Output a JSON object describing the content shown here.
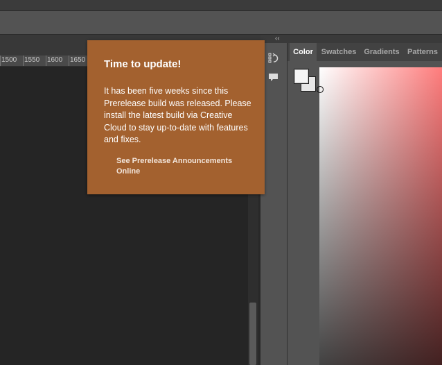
{
  "ruler": {
    "ticks": [
      "1500",
      "1550",
      "1600",
      "1650"
    ]
  },
  "panel": {
    "tabs": [
      {
        "label": "Color",
        "active": true
      },
      {
        "label": "Swatches",
        "active": false
      },
      {
        "label": "Gradients",
        "active": false
      },
      {
        "label": "Patterns",
        "active": false
      }
    ],
    "icons": [
      "history-icon",
      "comment-icon"
    ],
    "collapse_glyph": "‹‹",
    "foreground_color": "#f5f5f5",
    "background_color": "#e6e6e6",
    "hue_color": "#ff7c7c"
  },
  "toast": {
    "title": "Time to update!",
    "body": "It has been five weeks since this Prerelease build was released. Please install the latest build via Creative Cloud to stay up-to-date with features and fixes.",
    "link": "See Prerelease Announcements Online",
    "background": "#a3612f"
  }
}
